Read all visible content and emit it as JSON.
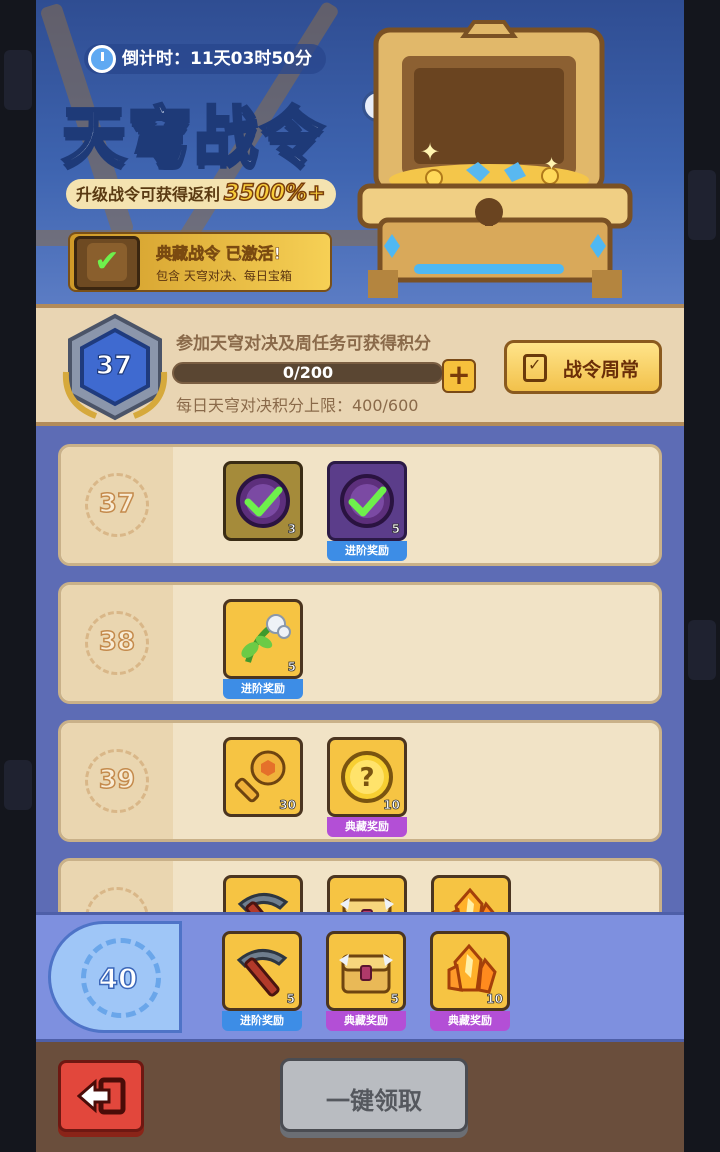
{
  "header": {
    "timer": "倒计时：11天03时50分",
    "title": "天穹战令",
    "help": "?",
    "upgrade_text": "升级战令可获得返利",
    "upgrade_percent": "3500%+",
    "activated_title_a": "典藏战令",
    "activated_title_b": "已激活!",
    "activated_sub": "包含 天穹对决、每日宝箱"
  },
  "progress": {
    "level": "37",
    "hint": "参加天穹对决及周任务可获得积分",
    "current": 0,
    "max": 200,
    "bar_text": "0/200",
    "plus": "+",
    "daily": "每日天穹对决积分上限：400/600",
    "weekly_button": "战令周常"
  },
  "tags": {
    "advanced": "进阶奖励",
    "collector": "典藏奖励"
  },
  "rows": [
    {
      "level": "37",
      "items": [
        {
          "icon": "claimed-check-icon",
          "count": "3",
          "tag": ""
        },
        {
          "icon": "claimed-check-icon",
          "count": "5",
          "tag": "进阶奖励"
        }
      ]
    },
    {
      "level": "38",
      "items": [
        {
          "icon": "plant-sprout-icon",
          "count": "5",
          "tag": "进阶奖励"
        }
      ]
    },
    {
      "level": "39",
      "items": [
        {
          "icon": "gold-key-icon",
          "count": "30",
          "tag": ""
        },
        {
          "icon": "mystery-coin-icon",
          "count": "10",
          "tag": "典藏奖励"
        }
      ]
    }
  ],
  "sticky_row": {
    "level": "40",
    "items": [
      {
        "icon": "pickaxe-icon",
        "count": "5",
        "tag": "进阶奖励"
      },
      {
        "icon": "treasure-chest-icon",
        "count": "5",
        "tag": "典藏奖励"
      },
      {
        "icon": "orange-crystal-icon",
        "count": "10",
        "tag": "典藏奖励"
      }
    ]
  },
  "bottom": {
    "back_icon": "exit-arrow-icon",
    "claim_all": "一键领取"
  },
  "colors": {
    "panel_bg": "#5d6cb5",
    "row_bg": "#f1e3c6",
    "item_gold": "#f6c443",
    "tag_advanced": "#3d8de6",
    "tag_collector": "#b34fd6",
    "back_button": "#e2473c",
    "claim_button_disabled": "#b9bcc1"
  }
}
